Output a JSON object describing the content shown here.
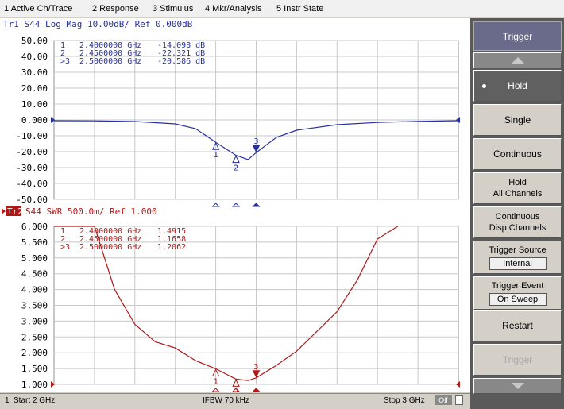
{
  "menu": [
    "1 Active Ch/Trace",
    "2 Response",
    "3 Stimulus",
    "4 Mkr/Analysis",
    "5 Instr State"
  ],
  "trace1": {
    "header": "Tr1  S44  Log Mag 10.00dB/ Ref 0.000dB",
    "y_labels": [
      "50.00",
      "40.00",
      "30.00",
      "20.00",
      "10.00",
      "0.000",
      "-10.00",
      "-20.00",
      "-30.00",
      "-40.00",
      "-50.00"
    ],
    "markers": [
      {
        "id": "1",
        "freq": "2.4000000 GHz",
        "value": "-14.098 dB"
      },
      {
        "id": "2",
        "freq": "2.4500000 GHz",
        "value": "-22.321 dB"
      },
      {
        "id": ">3",
        "freq": "2.5000000 GHz",
        "value": "-20.586 dB"
      }
    ],
    "color": "#2630a0"
  },
  "trace2": {
    "tag": "Tr2",
    "header": "S44  SWR 500.0m/ Ref 1.000",
    "y_labels": [
      "6.000",
      "5.500",
      "5.000",
      "4.500",
      "4.000",
      "3.500",
      "3.000",
      "2.500",
      "2.000",
      "1.500",
      "1.000"
    ],
    "markers": [
      {
        "id": "1",
        "freq": "2.4000000 GHz",
        "value": "1.4915"
      },
      {
        "id": "2",
        "freq": "2.4500000 GHz",
        "value": "1.1658"
      },
      {
        "id": ">3",
        "freq": "2.5000000 GHz",
        "value": "1.2062"
      }
    ],
    "color": "#b01818"
  },
  "chart_data": [
    {
      "type": "line",
      "title": "Tr1  S44  Log Mag 10.00dB/ Ref 0.000dB",
      "x_unit": "GHz",
      "xlim": [
        2.0,
        3.0
      ],
      "ylim": [
        -50,
        50
      ],
      "series": [
        {
          "x": [
            2.0,
            2.1,
            2.2,
            2.3,
            2.35,
            2.4,
            2.45,
            2.48,
            2.5,
            2.55,
            2.6,
            2.7,
            2.8,
            2.9,
            3.0
          ],
          "values": [
            -0.5,
            -0.6,
            -1.0,
            -2.5,
            -5.5,
            -14.098,
            -22.321,
            -25.0,
            -20.586,
            -11.0,
            -6.5,
            -3.0,
            -1.6,
            -0.9,
            -0.5
          ]
        }
      ],
      "marker_points": [
        {
          "x": 2.4,
          "y": -14.098
        },
        {
          "x": 2.45,
          "y": -22.321
        },
        {
          "x": 2.5,
          "y": -20.586
        }
      ]
    },
    {
      "type": "line",
      "title": "S44  SWR 500.0m/ Ref 1.000",
      "x_unit": "GHz",
      "xlim": [
        2.0,
        3.0
      ],
      "ylim": [
        1.0,
        6.0
      ],
      "series": [
        {
          "x": [
            2.0,
            2.1,
            2.15,
            2.2,
            2.25,
            2.3,
            2.35,
            2.4,
            2.45,
            2.48,
            2.5,
            2.55,
            2.6,
            2.7,
            2.75,
            2.8,
            2.85
          ],
          "values": [
            6.0,
            6.0,
            4.0,
            2.9,
            2.35,
            2.15,
            1.75,
            1.4915,
            1.1658,
            1.12,
            1.2062,
            1.6,
            2.05,
            3.3,
            4.3,
            5.6,
            6.0
          ]
        }
      ],
      "marker_points": [
        {
          "x": 2.4,
          "y": 1.4915
        },
        {
          "x": 2.45,
          "y": 1.1658
        },
        {
          "x": 2.5,
          "y": 1.2062
        }
      ]
    }
  ],
  "softkeys": {
    "title": "Trigger",
    "hold": "Hold",
    "single": "Single",
    "continuous": "Continuous",
    "hold_all_1": "Hold",
    "hold_all_2": "All Channels",
    "cont_disp_1": "Continuous",
    "cont_disp_2": "Disp Channels",
    "trig_source": "Trigger Source",
    "trig_source_val": "Internal",
    "trig_event": "Trigger Event",
    "trig_event_val": "On Sweep",
    "restart": "Restart",
    "trigger": "Trigger"
  },
  "status": {
    "channel": "1",
    "start": "Start 2 GHz",
    "ifbw": "IFBW 70 kHz",
    "stop": "Stop 3 GHz",
    "off": "Off"
  }
}
